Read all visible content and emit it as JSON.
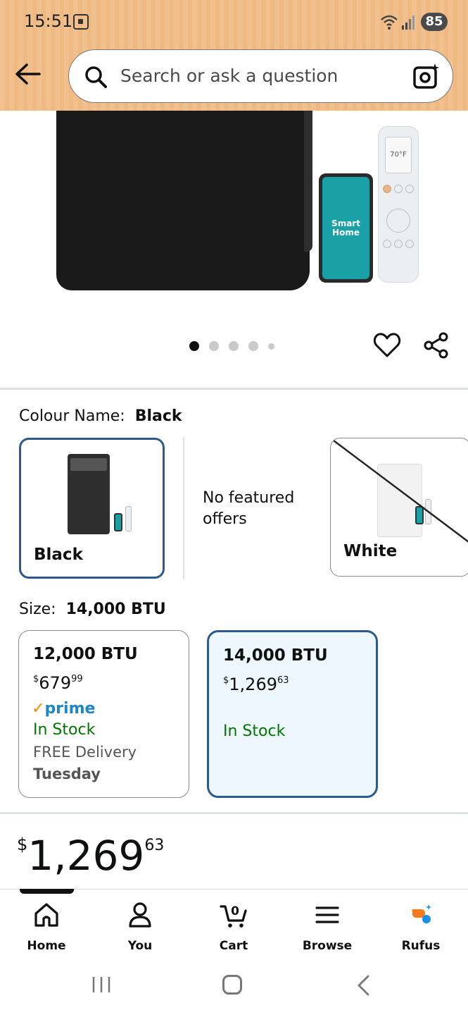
{
  "status_bar": {
    "time": "15:51",
    "battery": "85"
  },
  "search": {
    "placeholder": "Search or ask a question"
  },
  "product_image": {
    "phone_label_line1": "Smart",
    "phone_label_line2": "Home",
    "remote_display": "70°F",
    "image_count": 5,
    "active_image_index": 0
  },
  "colour": {
    "label": "Colour Name:",
    "selected_value": "Black",
    "options": [
      {
        "name": "Black",
        "selected": true,
        "available": true
      },
      {
        "name": "White",
        "selected": false,
        "available": false
      }
    ],
    "no_offers_text": "No featured offers"
  },
  "size": {
    "label": "Size:",
    "selected_value": "14,000 BTU",
    "options": [
      {
        "title": "12,000 BTU",
        "currency": "$",
        "price_whole": "679",
        "price_cents": "99",
        "prime": "prime",
        "stock": "In Stock",
        "delivery": "FREE Delivery",
        "delivery_day": "Tuesday",
        "selected": false
      },
      {
        "title": "14,000 BTU",
        "currency": "$",
        "price_whole": "1,269",
        "price_cents": "63",
        "stock": "In Stock",
        "selected": true
      }
    ]
  },
  "price": {
    "currency": "$",
    "whole": "1,269",
    "cents": "63"
  },
  "bottom_nav": {
    "items": [
      {
        "label": "Home",
        "icon": "home-icon"
      },
      {
        "label": "You",
        "icon": "person-icon"
      },
      {
        "label": "Cart",
        "icon": "cart-icon",
        "badge": "0"
      },
      {
        "label": "Browse",
        "icon": "menu-icon"
      },
      {
        "label": "Rufus",
        "icon": "rufus-icon"
      }
    ]
  },
  "colors": {
    "header_bg": "#f2c08c",
    "selected_border": "#2d5a8a",
    "in_stock": "#007600",
    "prime_blue": "#1f86c8"
  }
}
